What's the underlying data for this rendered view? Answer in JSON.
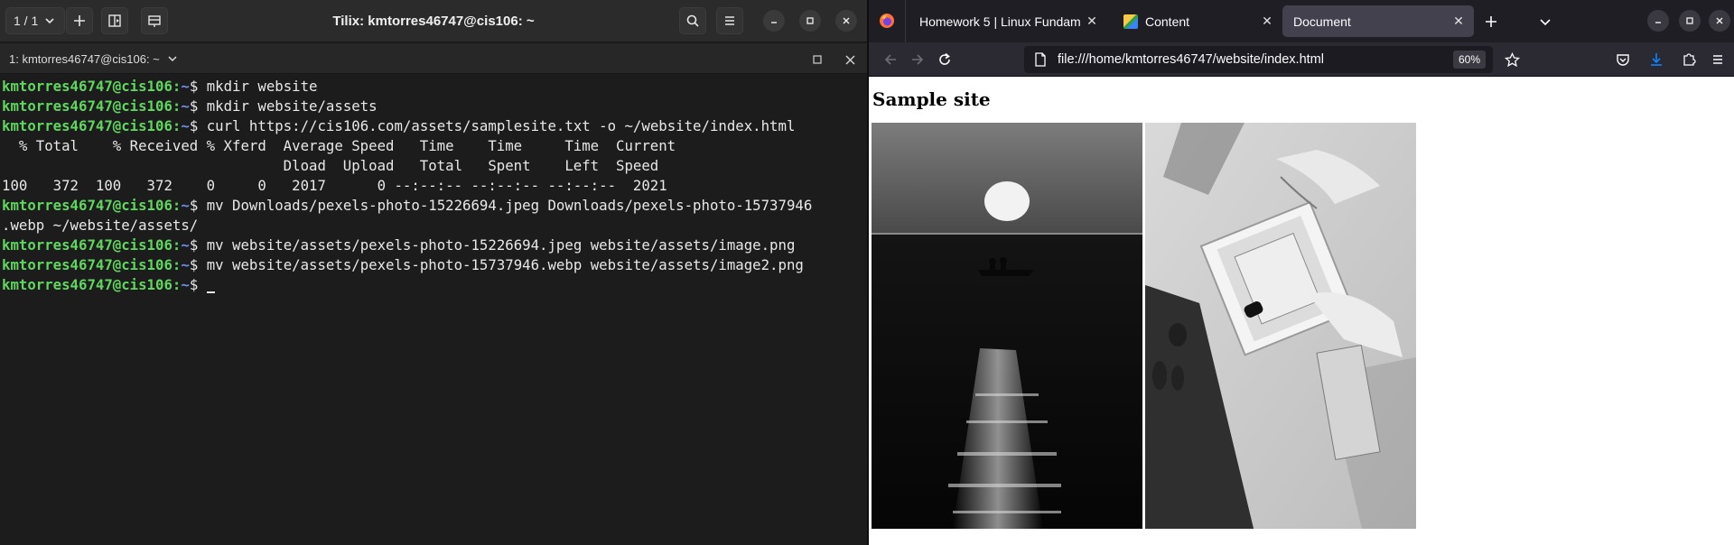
{
  "tilix": {
    "title": "Tilix: kmtorres46747@cis106: ~",
    "session_counter": "1 / 1",
    "session_tab": "1: kmtorres46747@cis106: ~",
    "prompt_user": "kmtorres46747@cis106",
    "prompt_sep": ":",
    "prompt_path": "~",
    "prompt_symbol": "$ ",
    "lines": [
      {
        "type": "prompt",
        "cmd": "mkdir website"
      },
      {
        "type": "prompt",
        "cmd": "mkdir website/assets"
      },
      {
        "type": "prompt",
        "cmd": "curl https://cis106.com/assets/samplesite.txt -o ~/website/index.html"
      },
      {
        "type": "output",
        "text": "  % Total    % Received % Xferd  Average Speed   Time    Time     Time  Current"
      },
      {
        "type": "output",
        "text": "                                 Dload  Upload   Total   Spent    Left  Speed"
      },
      {
        "type": "output",
        "text": "100   372  100   372    0     0   2017      0 --:--:-- --:--:-- --:--:--  2021"
      },
      {
        "type": "prompt",
        "cmd": "mv Downloads/pexels-photo-15226694.jpeg Downloads/pexels-photo-15737946"
      },
      {
        "type": "output",
        "text": ".webp ~/website/assets/"
      },
      {
        "type": "prompt",
        "cmd": "mv website/assets/pexels-photo-15226694.jpeg website/assets/image.png"
      },
      {
        "type": "prompt",
        "cmd": "mv website/assets/pexels-photo-15737946.webp website/assets/image2.png"
      },
      {
        "type": "prompt",
        "cmd": "",
        "cursor": true
      }
    ]
  },
  "firefox": {
    "tabs": [
      {
        "label": "Homework 5 | Linux Fundam",
        "active": false,
        "favicon": "firefox-icon"
      },
      {
        "label": "Content",
        "active": false,
        "favicon": "pencil-icon"
      },
      {
        "label": "Document",
        "active": true,
        "favicon": ""
      }
    ],
    "url": "file:///home/kmtorres46747/website/index.html",
    "zoom": "60%",
    "page": {
      "heading": "Sample site",
      "images": [
        {
          "name": "sunset-boat-image"
        },
        {
          "name": "perfume-box-image"
        }
      ]
    }
  },
  "colors": {
    "prompt_user": "#5fd75f",
    "prompt_path": "#6a8fe8",
    "terminal_bg": "#1c1c1c",
    "firefox_chrome": "#2b2a33",
    "download_accent": "#0a84ff"
  }
}
